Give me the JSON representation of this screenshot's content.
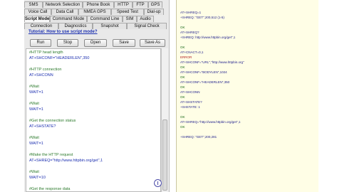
{
  "tabs_row1": [
    "SMS",
    "Network Selection",
    "Phone Book",
    "HTTP",
    "FTP",
    "GPS"
  ],
  "tabs_row2": [
    "Voice Call",
    "Data Call",
    "NMEA GPS",
    "Speed Test",
    "Dial-up"
  ],
  "tabs_row3": [
    "Script Mode",
    "Command Mode",
    "Command Line",
    "SIM",
    "Audio"
  ],
  "tabs_row4": [
    "Connection",
    "Diagnostics",
    "Snapshot",
    "Signal Check"
  ],
  "help_link": "Tutorial: How to use script mode?",
  "buttons": {
    "run": "Run",
    "stop": "Stop",
    "open": "Open",
    "save": "Save",
    "save_as": "Save As"
  },
  "script_lines": [
    "#HTTP head length",
    "AT+SHCONF=\"HEADERLEN\",350",
    "",
    "#HTTP connection",
    "AT+SHCONN",
    "",
    "#Wait",
    "WAIT=1",
    "",
    "#Wait",
    "WAIT=1",
    "",
    "#Get the connection status",
    "AT+SHSTATE?",
    "",
    "#Wait",
    "WAIT=1",
    "",
    "#Make the HTTP request",
    "AT+SHREQ=\"http://www.httpbin.org/get\",1",
    "",
    "#Wait",
    "WAIT=10",
    "",
    "#Get the response data"
  ],
  "log_lines": [
    "AT+SHREQ=1",
    "+SHREQ: \"GET\",200,512 (1-5)",
    "",
    "OK",
    "AT+SHREQ?",
    "+SHREQ: http://www.httpbin.org/get\",1",
    "",
    "OK",
    "AT+CNACT=0,1",
    "ERROR",
    "AT+SHCONF=\"URL\",\"http://www.httpbin.org\"",
    "OK",
    "AT+SHCONF=\"BODYLEN\",1024",
    "OK",
    "AT+SHCONF=\"HEADERLEN\",350",
    "OK",
    "AT+SHCONN",
    "OK",
    "AT+SHSTATE?",
    "+SHSTATE: 1",
    "",
    "OK",
    "AT+SHREQ=\"http://www.httpbin.org/get\",1",
    "OK",
    "",
    "+SHREQ: \"GET\",200,281"
  ],
  "colors": {
    "comment": "#2c7a2c",
    "code": "#1c2fb0",
    "log_bg": "#fffee6",
    "link": "#1a2fb0"
  },
  "icons": {
    "record": "record-icon"
  }
}
